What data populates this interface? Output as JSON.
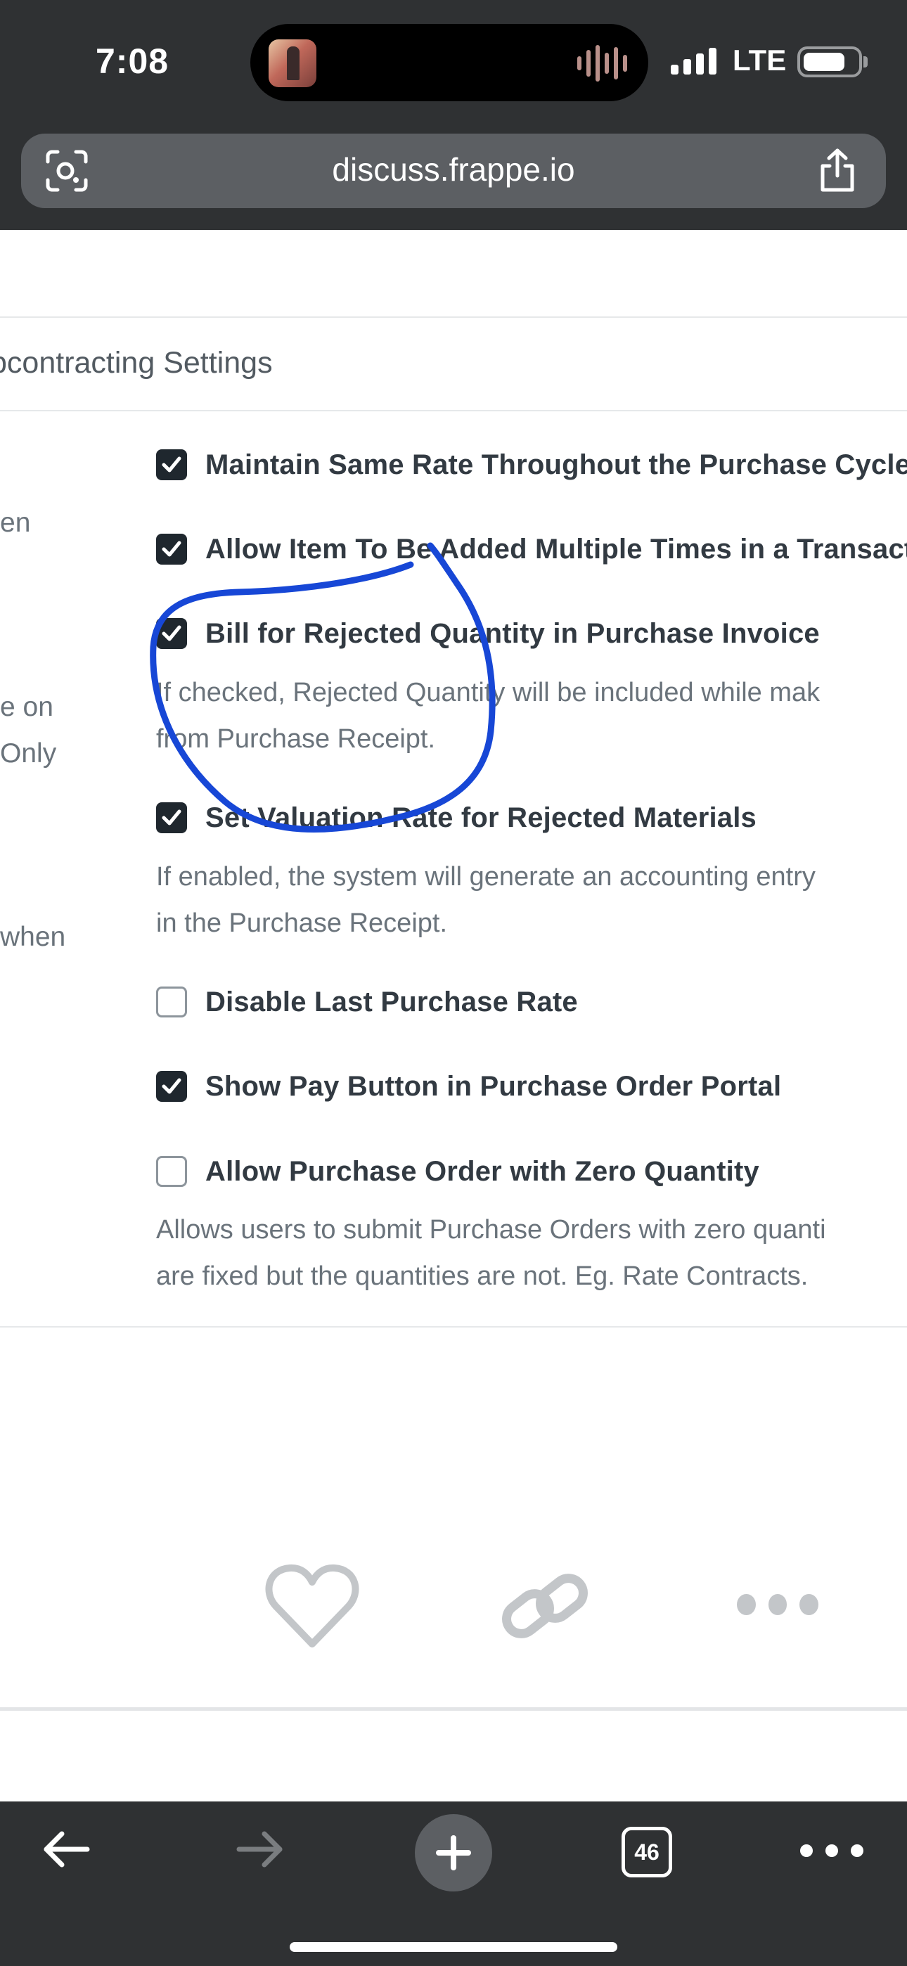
{
  "status_bar": {
    "time": "7:08",
    "network": "LTE",
    "battery_level": 0.7,
    "signal_bars": 4
  },
  "browser": {
    "url": "discuss.frappe.io",
    "toolbar": {
      "tab_count": "46"
    }
  },
  "settings": {
    "section_title": "bcontracting Settings",
    "left_column_fragments": [
      "en",
      "e on",
      "Only",
      "when"
    ],
    "options": [
      {
        "label": "Maintain Same Rate Throughout the Purchase Cycle",
        "checked": true,
        "description": []
      },
      {
        "label": "Allow Item To Be Added Multiple Times in a Transact",
        "checked": true,
        "description": []
      },
      {
        "label": "Bill for Rejected Quantity in Purchase Invoice",
        "checked": true,
        "description": [
          "If checked, Rejected Quantity will be included while mak",
          "from Purchase Receipt."
        ]
      },
      {
        "label": "Set Valuation Rate for Rejected Materials",
        "checked": true,
        "description": [
          "If enabled, the system will generate an accounting entry",
          "in the Purchase Receipt."
        ]
      },
      {
        "label": "Disable Last Purchase Rate",
        "checked": false,
        "description": []
      },
      {
        "label": "Show Pay Button in Purchase Order Portal",
        "checked": true,
        "description": []
      },
      {
        "label": "Allow Purchase Order with Zero Quantity",
        "checked": false,
        "description": [
          "Allows users to submit Purchase Orders with zero quanti",
          "are fixed but the quantities are not. Eg. Rate Contracts."
        ]
      }
    ]
  },
  "post_actions": {
    "like_icon": "heart-icon",
    "link_icon": "link-icon",
    "more_icon": "more-icon"
  },
  "colors": {
    "chrome": "#2f3133",
    "annotation": "#1747d6",
    "checkbox_checked": "#1f272e"
  }
}
